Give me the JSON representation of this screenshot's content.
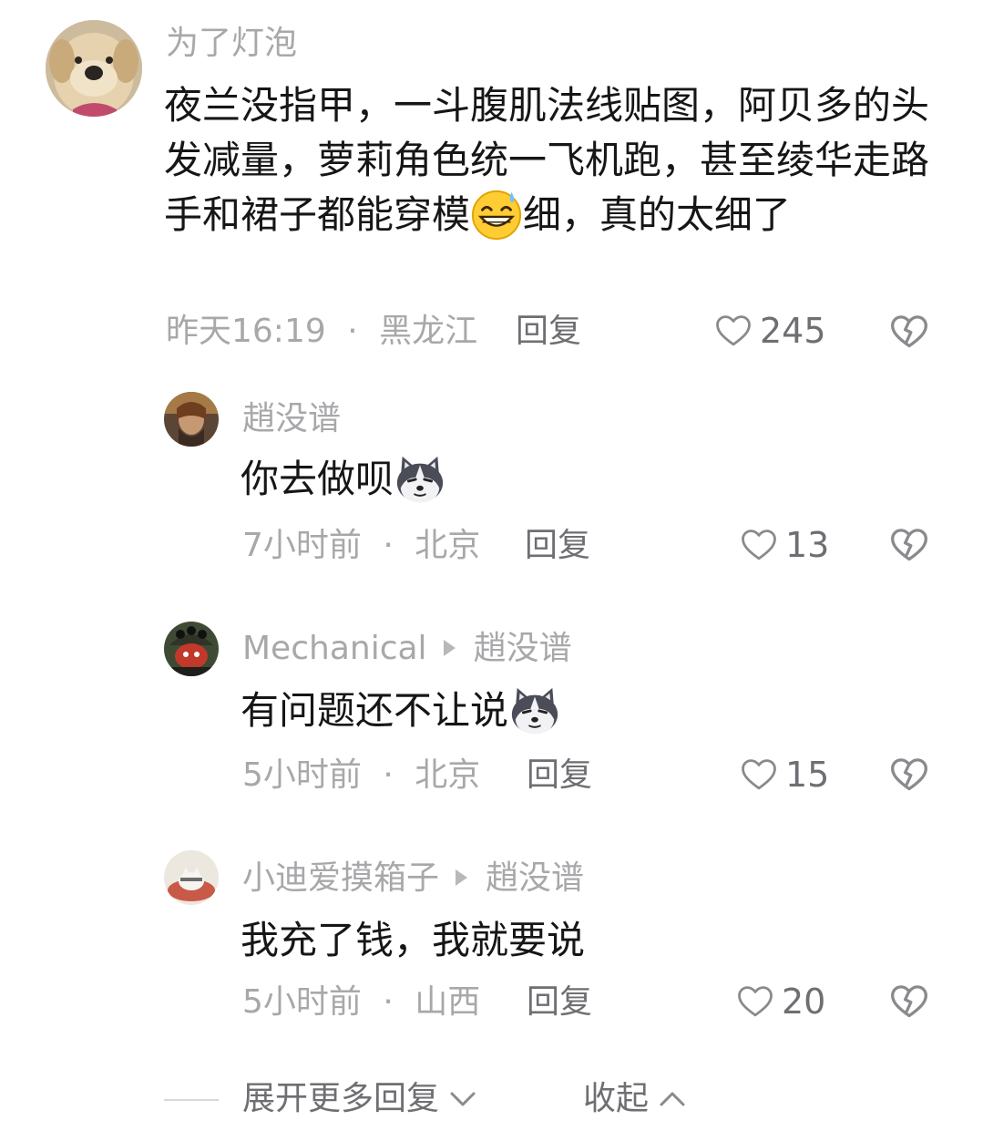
{
  "comment": {
    "author": "为了灯泡",
    "text_part1": "夜兰没指甲，一斗腹肌法线贴图，阿贝多的头发减量，萝莉角色统一飞机跑，甚至绫华走路手和裙子都能穿模",
    "text_part2": "细，真的太细了",
    "emoji": "grinning-sweat-emoji",
    "time": "昨天16:19",
    "location": "黑龙江",
    "reply_label": "回复",
    "likes": "245"
  },
  "replies": [
    {
      "author": "趙没谱",
      "text": "你去做呗",
      "emoji": "husky-dog-emoji",
      "time": "7小时前",
      "location": "北京",
      "reply_label": "回复",
      "likes": "13"
    },
    {
      "author": "Mechanical",
      "reply_to": "趙没谱",
      "text": "有问题还不让说",
      "emoji": "husky-dog-emoji",
      "time": "5小时前",
      "location": "北京",
      "reply_label": "回复",
      "likes": "15"
    },
    {
      "author": "小迪爱摸箱子",
      "reply_to": "趙没谱",
      "text": "我充了钱，我就要说",
      "time": "5小时前",
      "location": "山西",
      "reply_label": "回复",
      "likes": "20"
    }
  ],
  "footer": {
    "expand_label": "展开更多回复",
    "collapse_label": "收起"
  },
  "icons": {
    "like": "heart-outline-icon",
    "dislike": "broken-heart-icon",
    "expand": "chevron-down-icon",
    "collapse": "chevron-up-icon",
    "reply_arrow": "triangle-right-icon"
  },
  "colors": {
    "text_primary": "#161616",
    "text_muted": "#a8a8ab",
    "text_secondary": "#6e6e73",
    "background": "#ffffff"
  }
}
